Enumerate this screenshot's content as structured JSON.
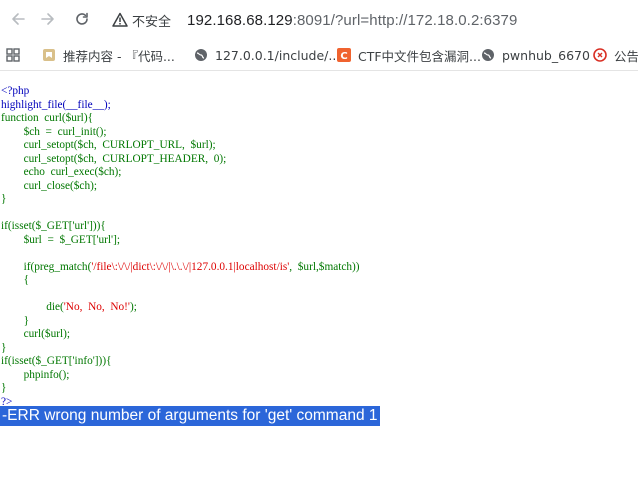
{
  "browser": {
    "insecure_label": "不安全",
    "url_host": "192.168.68.129",
    "url_rest": ":8091/?url=http://172.18.0.2:6379"
  },
  "bookmarks": [
    {
      "label": "推荐内容 - 『代码...",
      "icon": "bookmark-folder-icon"
    },
    {
      "label": "127.0.0.1/include/...",
      "icon": "globe-icon"
    },
    {
      "label": "CTF中文件包含漏洞...",
      "icon": "csdn-icon"
    },
    {
      "label": "pwnhub_6670",
      "icon": "globe-icon"
    },
    {
      "label": "公告(",
      "icon": "site-icon"
    }
  ],
  "code": {
    "l01": "<?php",
    "l02": "highlight_file(__file__);",
    "l03": "function  curl($url){",
    "l04": "        $ch  =  curl_init();",
    "l05": "        curl_setopt($ch,  CURLOPT_URL,  $url);",
    "l06": "        curl_setopt($ch,  CURLOPT_HEADER,  0);",
    "l07": "        echo  curl_exec($ch);",
    "l08": "        curl_close($ch);",
    "l09": "}",
    "l10": "",
    "l11": "if(isset($_GET['url'])){",
    "l12": "        $url  =  $_GET['url'];",
    "l13": "",
    "l14a": "        if(preg_match(",
    "l14b": "'/file\\:\\/\\/|dict\\:\\/\\/|\\.\\.\\/|127.0.0.1|localhost/is'",
    "l14c": ",  $url,$match))",
    "l15": "        {",
    "l16": "",
    "l17a": "                die(",
    "l17b": "'No,  No,  No!'",
    "l17c": ");",
    "l18": "        }",
    "l19": "        curl($url);",
    "l20": "}",
    "l21": "if(isset($_GET['info'])){",
    "l22": "        phpinfo();",
    "l23": "}",
    "l24": "?>"
  },
  "output": "-ERR wrong number of arguments for 'get' command 1",
  "colors": {
    "keyword": "#007700",
    "string": "#dd0000",
    "default": "#0000bb",
    "delimiter": "#ff8000",
    "selection": "#2b66d9"
  }
}
